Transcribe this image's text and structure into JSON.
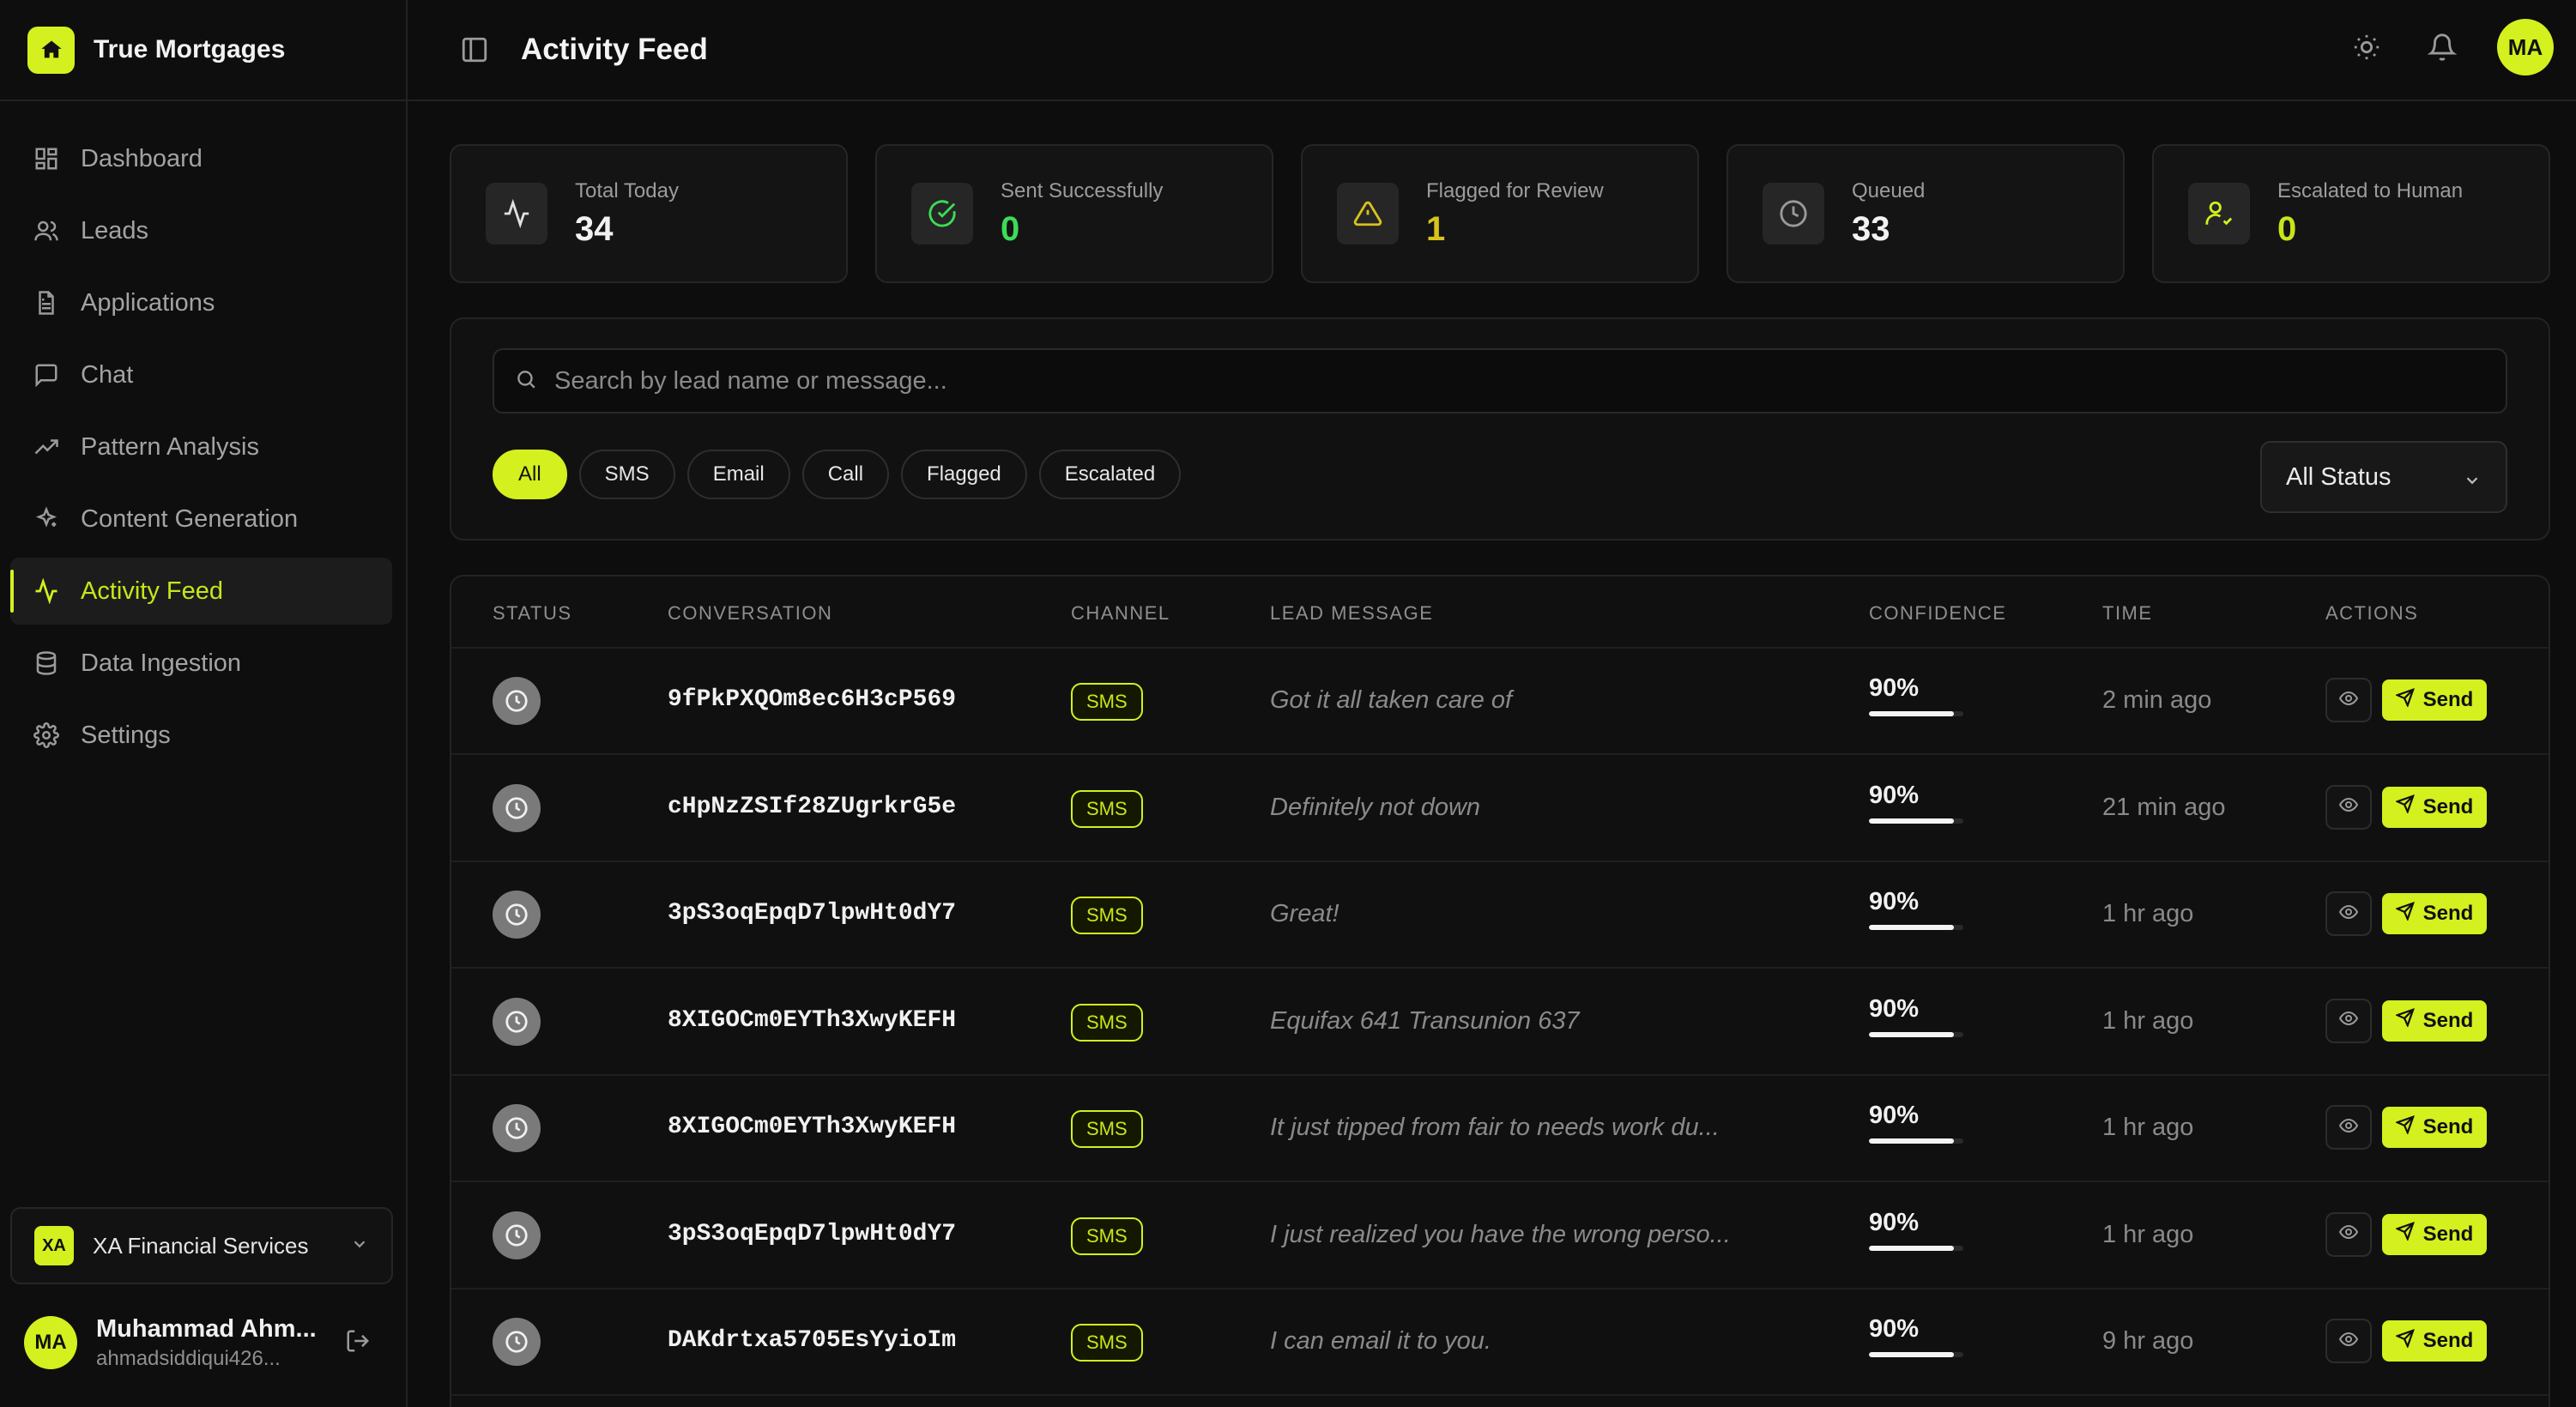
{
  "app": {
    "name": "True Mortgages"
  },
  "header": {
    "title": "Activity Feed"
  },
  "sidebar": {
    "items": [
      {
        "label": "Dashboard",
        "icon": "dashboard-icon"
      },
      {
        "label": "Leads",
        "icon": "users-icon"
      },
      {
        "label": "Applications",
        "icon": "file-text-icon"
      },
      {
        "label": "Chat",
        "icon": "message-square-icon"
      },
      {
        "label": "Pattern Analysis",
        "icon": "trending-up-icon"
      },
      {
        "label": "Content Generation",
        "icon": "sparkles-icon"
      },
      {
        "label": "Activity Feed",
        "icon": "activity-icon",
        "active": true
      },
      {
        "label": "Data Ingestion",
        "icon": "database-icon"
      },
      {
        "label": "Settings",
        "icon": "gear-icon"
      }
    ],
    "org": {
      "badge": "XA",
      "name": "XA Financial Services"
    },
    "user": {
      "initials": "MA",
      "name": "Muhammad Ahm...",
      "email": "ahmadsiddiqui426..."
    }
  },
  "topbar": {
    "avatar_initials": "MA"
  },
  "stats": [
    {
      "label": "Total Today",
      "value": "34",
      "icon": "activity-icon"
    },
    {
      "label": "Sent Successfully",
      "value": "0",
      "icon": "check-circle-icon"
    },
    {
      "label": "Flagged for Review",
      "value": "1",
      "icon": "alert-triangle-icon"
    },
    {
      "label": "Queued",
      "value": "33",
      "icon": "clock-icon"
    },
    {
      "label": "Escalated to Human",
      "value": "0",
      "icon": "user-check-icon"
    }
  ],
  "filters": {
    "search_placeholder": "Search by lead name or message...",
    "chips": [
      "All",
      "SMS",
      "Email",
      "Call",
      "Flagged",
      "Escalated"
    ],
    "active_chip": "All",
    "status_select": "All Status"
  },
  "table": {
    "columns": [
      "STATUS",
      "CONVERSATION",
      "CHANNEL",
      "LEAD MESSAGE",
      "CONFIDENCE",
      "TIME",
      "ACTIONS"
    ],
    "send_label": "Send",
    "rows": [
      {
        "conversation": "9fPkPXQOm8ec6H3cP569",
        "channel": "SMS",
        "message": "Got it all taken care of",
        "confidence": "90%",
        "confidence_value": 0.9,
        "time": "2 min ago"
      },
      {
        "conversation": "cHpNzZSIf28ZUgrkrG5e",
        "channel": "SMS",
        "message": "Definitely not down",
        "confidence": "90%",
        "confidence_value": 0.9,
        "time": "21 min ago"
      },
      {
        "conversation": "3pS3oqEpqD7lpwHt0dY7",
        "channel": "SMS",
        "message": "Great!",
        "confidence": "90%",
        "confidence_value": 0.9,
        "time": "1 hr ago"
      },
      {
        "conversation": "8XIGOCm0EYTh3XwyKEFH",
        "channel": "SMS",
        "message": "Equifax 641 Transunion 637",
        "confidence": "90%",
        "confidence_value": 0.9,
        "time": "1 hr ago"
      },
      {
        "conversation": "8XIGOCm0EYTh3XwyKEFH",
        "channel": "SMS",
        "message": "It just tipped from fair to needs work du...",
        "confidence": "90%",
        "confidence_value": 0.9,
        "time": "1 hr ago"
      },
      {
        "conversation": "3pS3oqEpqD7lpwHt0dY7",
        "channel": "SMS",
        "message": "I just realized you have the wrong perso...",
        "confidence": "90%",
        "confidence_value": 0.9,
        "time": "1 hr ago"
      },
      {
        "conversation": "DAKdrtxa5705EsYyioIm",
        "channel": "SMS",
        "message": "I can email it to you.",
        "confidence": "90%",
        "confidence_value": 0.9,
        "time": "9 hr ago"
      }
    ]
  },
  "colors": {
    "accent": "#d4f01e",
    "background": "#0d0d0d",
    "success": "#3ddc57",
    "warning": "#d8c21c"
  }
}
